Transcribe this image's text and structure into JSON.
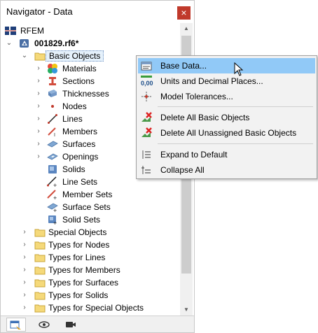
{
  "window": {
    "title": "Navigator - Data",
    "close_glyph": "×"
  },
  "tree": {
    "root": "RFEM",
    "file": "001829.rf6*",
    "selected": "Basic Objects",
    "basic_objects": [
      "Materials",
      "Sections",
      "Thicknesses",
      "Nodes",
      "Lines",
      "Members",
      "Surfaces",
      "Openings",
      "Solids",
      "Line Sets",
      "Member Sets",
      "Surface Sets",
      "Solid Sets"
    ],
    "folders": [
      "Special Objects",
      "Types for Nodes",
      "Types for Lines",
      "Types for Members",
      "Types for Surfaces",
      "Types for Solids",
      "Types for Special Objects"
    ]
  },
  "context_menu": {
    "items": [
      "Base Data...",
      "Units and Decimal Places...",
      "Model Tolerances...",
      "Delete All Basic Objects",
      "Delete All Unassigned Basic Objects",
      "Expand to Default",
      "Collapse All"
    ],
    "highlighted": "Base Data...",
    "units_icon_text": "0,00"
  },
  "bottom_tabs": [
    "data-tab",
    "display-tab",
    "views-tab"
  ],
  "colors": {
    "menu_highlight": "#91c9f7",
    "close_button": "#c0392b",
    "folder": "#f5d97a",
    "selection": "#e5f1fb"
  }
}
